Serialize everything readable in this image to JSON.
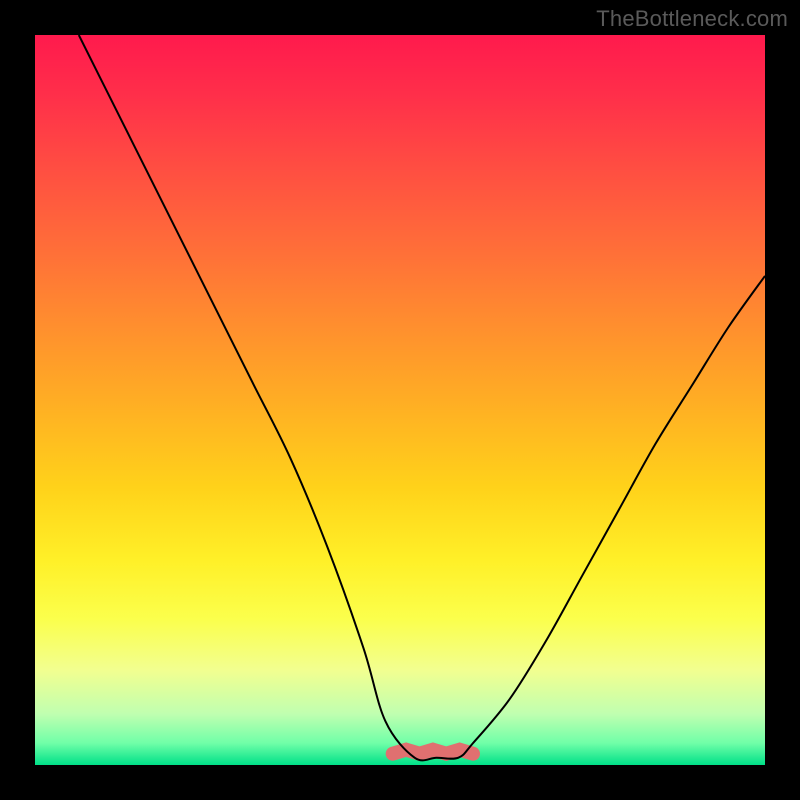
{
  "watermark": "TheBottleneck.com",
  "colors": {
    "frame": "#000000",
    "curve": "#000000",
    "flat_segment": "#e07070"
  },
  "chart_data": {
    "type": "line",
    "title": "",
    "xlabel": "",
    "ylabel": "",
    "xlim": [
      0,
      100
    ],
    "ylim": [
      0,
      100
    ],
    "grid": false,
    "legend": false,
    "series": [
      {
        "name": "bottleneck-curve",
        "x": [
          6,
          10,
          15,
          20,
          25,
          30,
          35,
          40,
          45,
          48,
          52,
          55,
          58,
          60,
          65,
          70,
          75,
          80,
          85,
          90,
          95,
          100
        ],
        "values": [
          100,
          92,
          82,
          72,
          62,
          52,
          42,
          30,
          16,
          6,
          1,
          1,
          1,
          3,
          9,
          17,
          26,
          35,
          44,
          52,
          60,
          67
        ]
      }
    ],
    "annotations": [
      {
        "name": "optimal-flat-region",
        "x_start": 49,
        "x_end": 60,
        "y": 1
      }
    ],
    "background_gradient_stops": [
      {
        "pos": 0.0,
        "color": "#ff1a4d"
      },
      {
        "pos": 0.5,
        "color": "#ffad24"
      },
      {
        "pos": 0.8,
        "color": "#fbff4c"
      },
      {
        "pos": 1.0,
        "color": "#00e088"
      }
    ]
  }
}
